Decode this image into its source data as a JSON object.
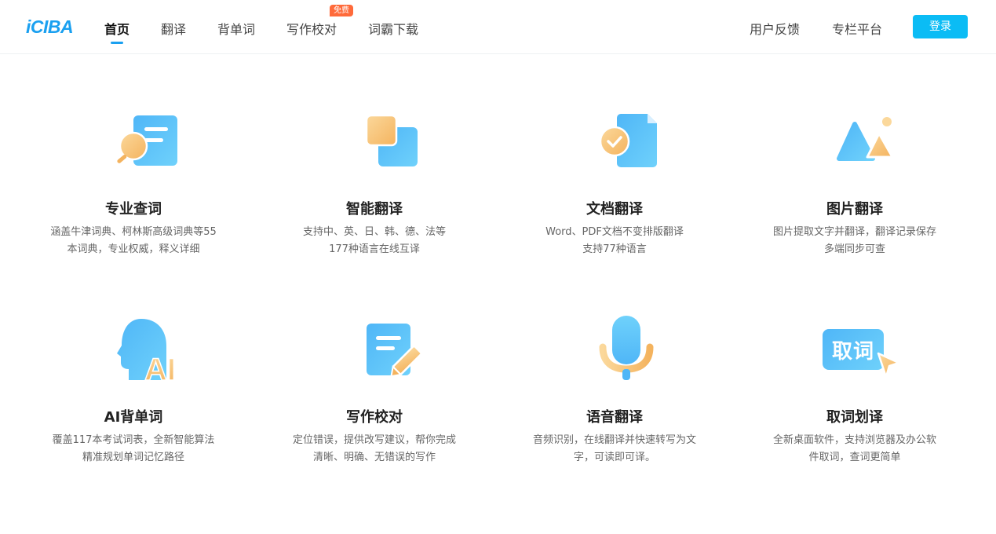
{
  "header": {
    "logo": "iCIBA",
    "nav": [
      {
        "label": "首页"
      },
      {
        "label": "翻译"
      },
      {
        "label": "背单词"
      },
      {
        "label": "写作校对"
      },
      {
        "label": "词霸下载"
      }
    ],
    "badge": "免费",
    "feedback": "用户反馈",
    "column": "专栏平台",
    "login": "登录",
    "accent_color": "#1aa0f0",
    "login_color": "#0bbcf5"
  },
  "features": [
    {
      "title": "专业查词",
      "desc1": "涵盖牛津词典、柯林斯高级词典等55",
      "desc2": "本词典，专业权威，释义详细",
      "icon": "dictionary-search-icon"
    },
    {
      "title": "智能翻译",
      "desc1": "支持中、英、日、韩、德、法等",
      "desc2": "177种语言在线互译",
      "icon": "translate-squares-icon"
    },
    {
      "title": "文档翻译",
      "desc1": "Word、PDF文档不变排版翻译",
      "desc2": "支持77种语言",
      "icon": "document-check-icon"
    },
    {
      "title": "图片翻译",
      "desc1": "图片提取文字并翻译，翻译记录保存",
      "desc2": "多端同步可查",
      "icon": "image-mountain-icon"
    },
    {
      "title": "AI背单词",
      "desc1": "覆盖117本考试词表，全新智能算法",
      "desc2": "精准规划单词记忆路径",
      "icon": "ai-head-icon"
    },
    {
      "title": "写作校对",
      "desc1": "定位错误，提供改写建议，帮你完成",
      "desc2": "清晰、明确、无错误的写作",
      "icon": "writing-pencil-icon"
    },
    {
      "title": "语音翻译",
      "desc1": "音频识别，在线翻译并快速转写为文",
      "desc2": "字，可读即可译。",
      "icon": "microphone-icon"
    },
    {
      "title": "取词划译",
      "desc1": "全新桌面软件，支持浏览器及办公软",
      "desc2": "件取词，查词更简单",
      "icon": "word-pick-cursor-icon",
      "icon_text": "取词"
    }
  ]
}
